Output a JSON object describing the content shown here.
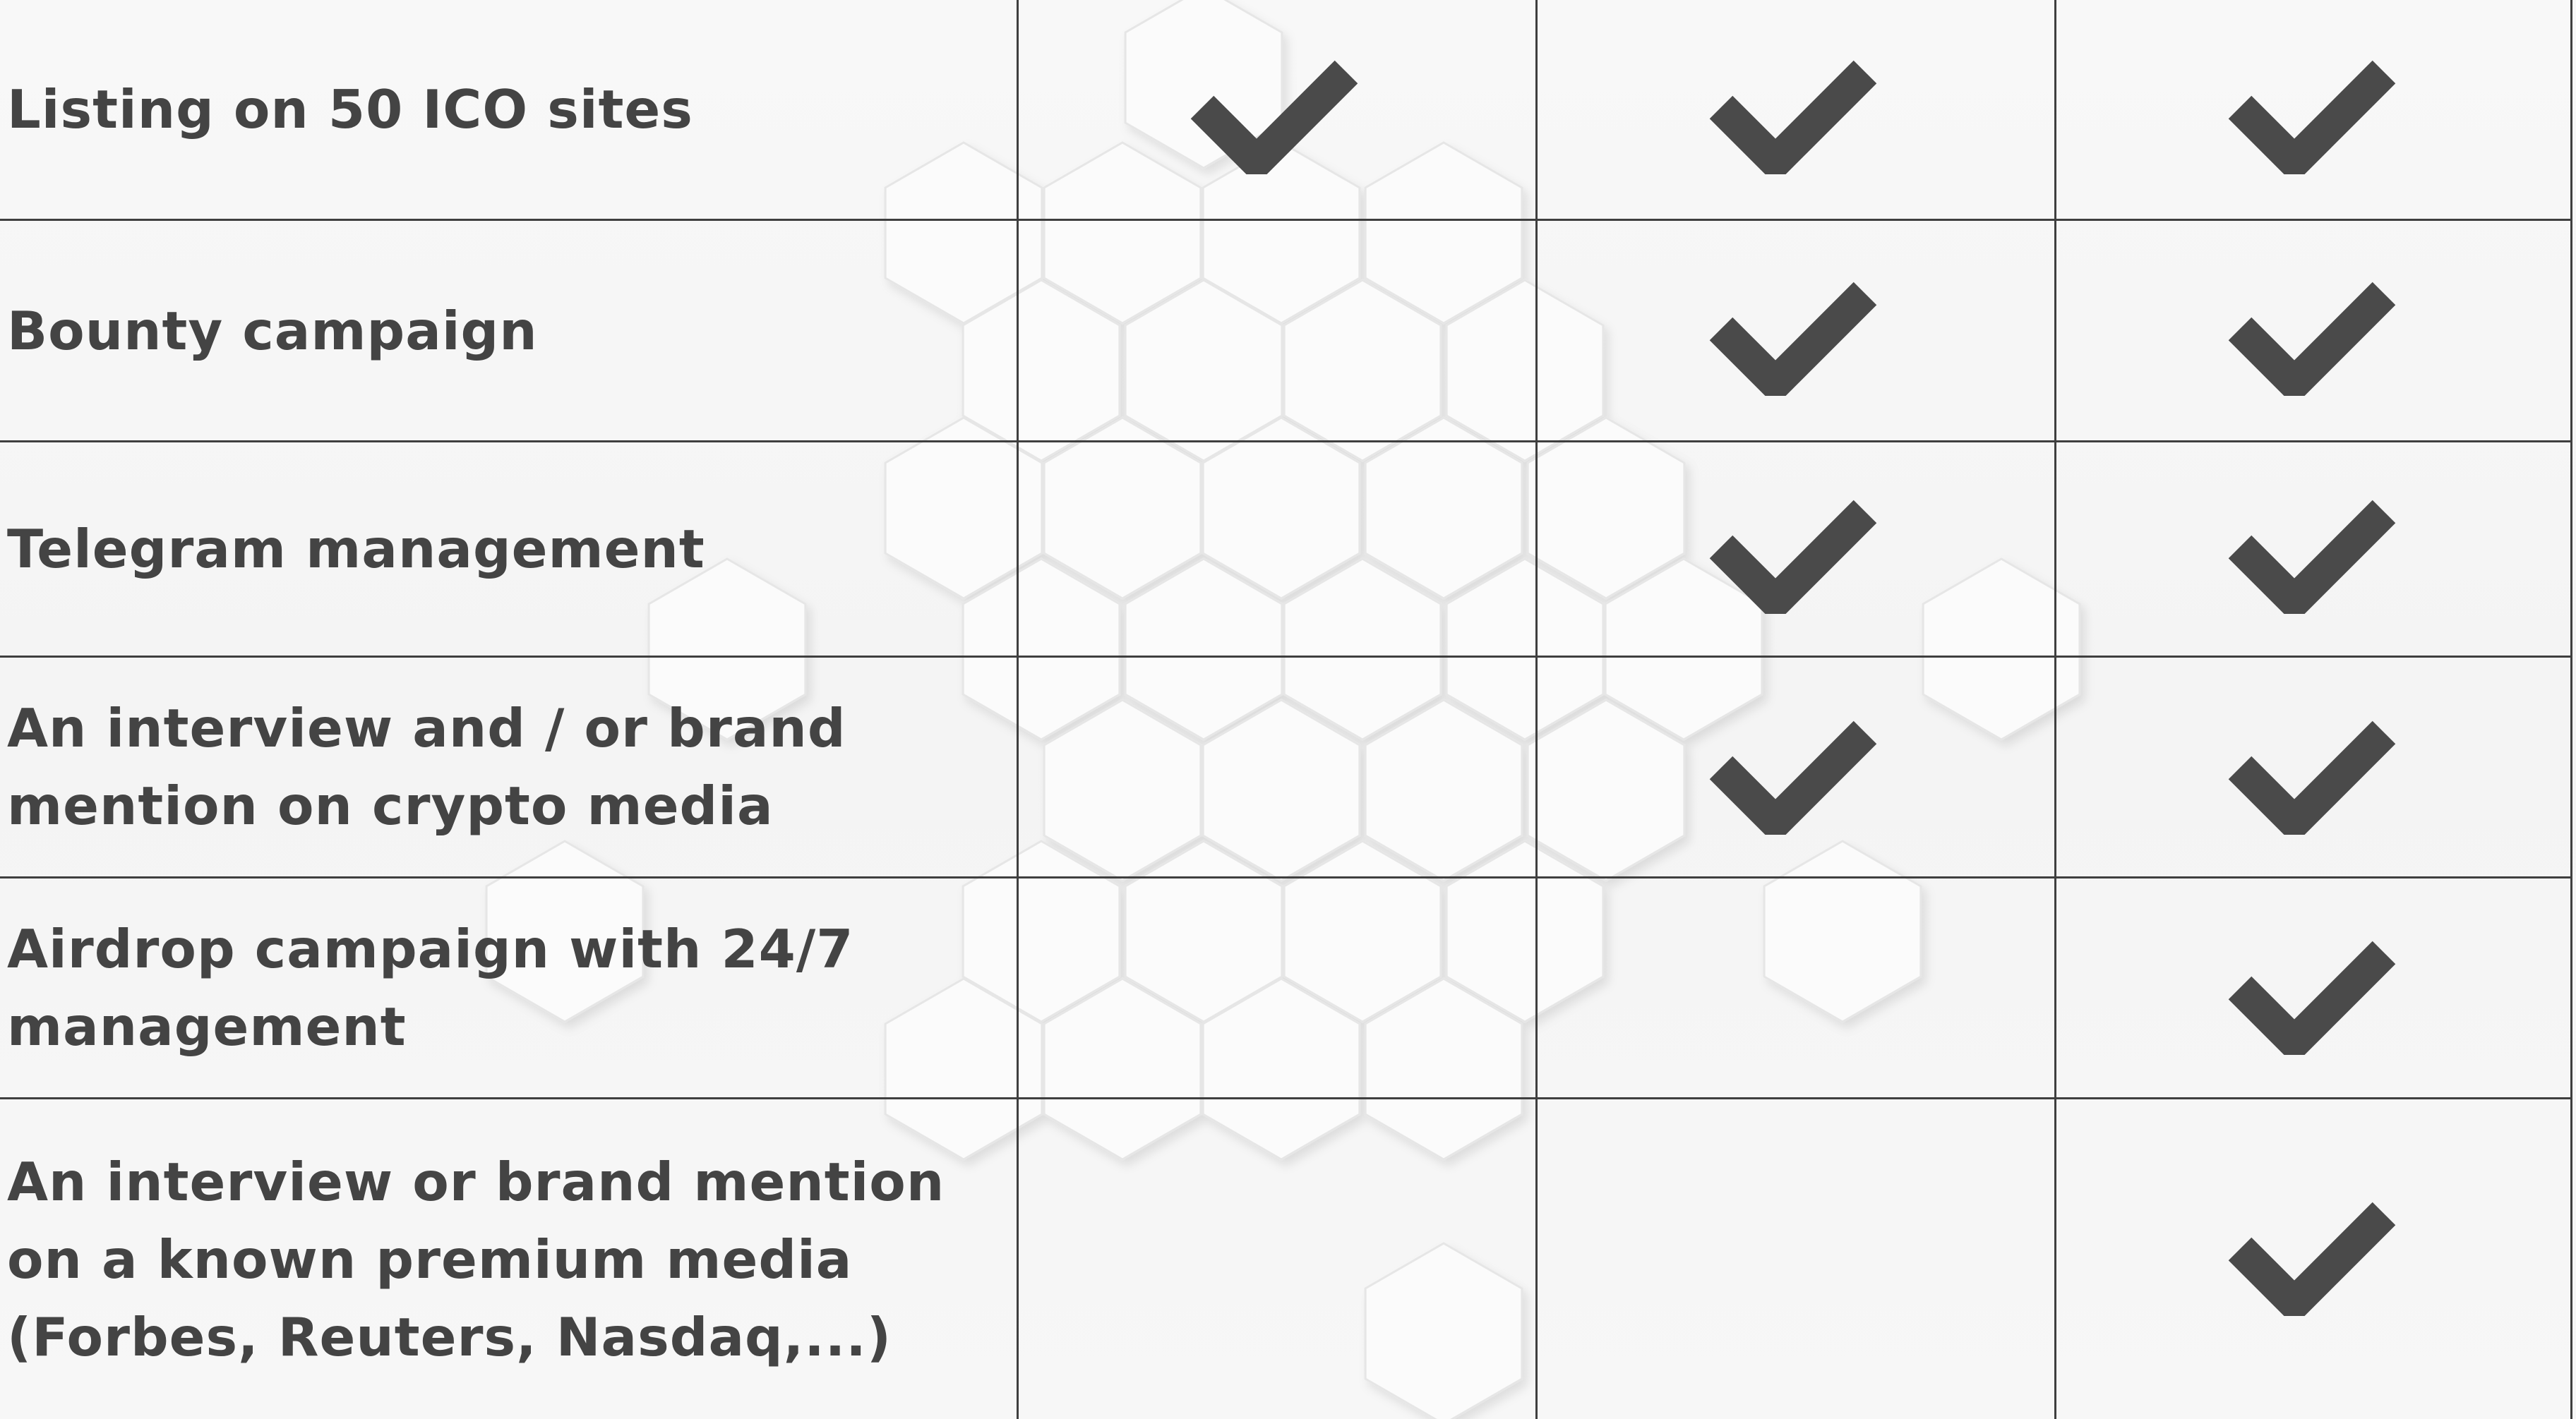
{
  "theme": {
    "text_color": "#444444",
    "line_color": "#3f3f3f",
    "check_color": "#4a4a4a",
    "background": "#f6f6f6"
  },
  "background_pattern": "hexagon-emboss",
  "check_icon": "checkmark-icon",
  "table": {
    "columns": [
      "feature",
      "package-1",
      "package-2",
      "package-3"
    ],
    "rows": [
      {
        "label": "Listing on 50 ICO sites",
        "checks": [
          true,
          true,
          true
        ]
      },
      {
        "label": "Bounty campaign",
        "checks": [
          false,
          true,
          true
        ]
      },
      {
        "label": "Telegram management",
        "checks": [
          false,
          true,
          true
        ]
      },
      {
        "label": "An interview and / or brand\nmention on crypto media",
        "checks": [
          false,
          true,
          true
        ]
      },
      {
        "label": "Airdrop campaign with 24/7\nmanagement",
        "checks": [
          false,
          false,
          true
        ]
      },
      {
        "label": "An interview or brand mention\non a known premium media\n(Forbes, Reuters, Nasdaq,...)",
        "checks": [
          false,
          false,
          true
        ]
      }
    ]
  }
}
